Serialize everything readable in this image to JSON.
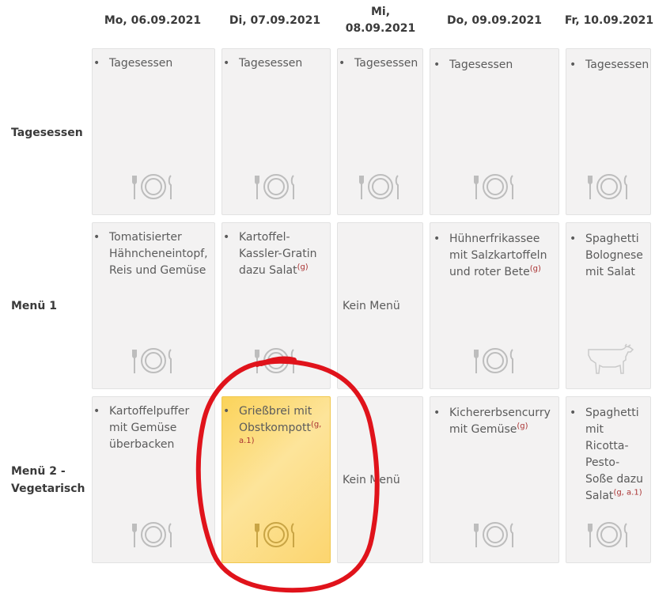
{
  "days": [
    "Mo, 06.09.2021",
    "Di, 07.09.2021",
    "Mi,",
    "08.09.2021",
    "Do, 09.09.2021",
    "Fr, 10.09.2021"
  ],
  "rows": [
    "Tagesessen",
    "Menü 1",
    "Menü 2 -",
    "Vegetarisch"
  ],
  "tagesessen": [
    "Tagesessen",
    "Tagesessen",
    "Tagesessen",
    "Tagesessen",
    "Tagesessen"
  ],
  "menu1": {
    "mo": [
      "Tomatisierter",
      "Hähncheneintopf,",
      "Reis und Gemüse"
    ],
    "di": [
      "Kartoffel-",
      "Kassler-Gratin",
      "dazu Salat",
      "(g)"
    ],
    "mi": "Kein Menü",
    "do": [
      "Hühnerfrikassee",
      "mit Salzkartoffeln",
      "und roter Bete",
      "(g)"
    ],
    "fr": [
      "Spaghetti",
      "Bolognese",
      "mit Salat"
    ]
  },
  "menu2": {
    "mo": [
      "Kartoffelpuffer",
      "mit Gemüse",
      "überbacken"
    ],
    "di": [
      "Grießbrei mit",
      "Obstkompott",
      "(g,",
      "a.1)"
    ],
    "mi": "Kein Menü",
    "do": [
      "Kichererbsencurry",
      "mit Gemüse",
      "(g)"
    ],
    "fr": [
      "Spaghetti",
      "mit",
      "Ricotta-",
      "Pesto-",
      "Soße dazu",
      "Salat",
      "(g, a.1)"
    ]
  },
  "icons": {
    "plate": "plate-cutlery-icon",
    "cow": "cow-icon"
  },
  "colors": {
    "selected": "#fcd56f",
    "cell": "#f3f2f2",
    "annotation": "#e0131b"
  }
}
